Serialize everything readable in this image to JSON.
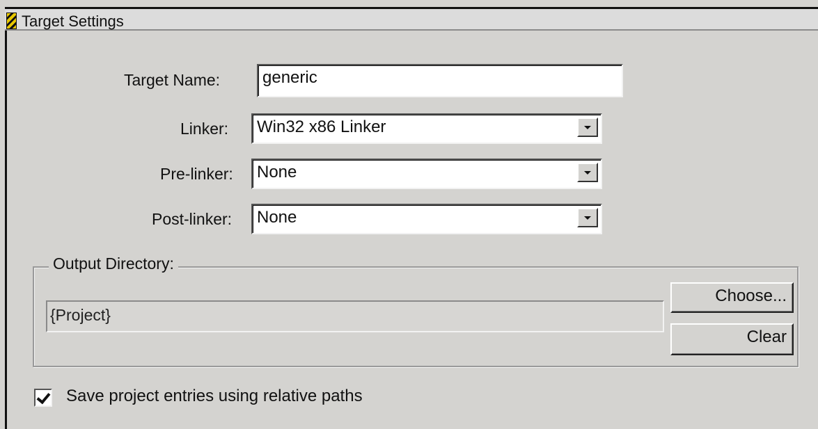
{
  "window": {
    "title": "Target Settings",
    "icon": "target-settings-icon"
  },
  "form": {
    "target_name_label": "Target Name:",
    "target_name_value": "generic",
    "linker_label": "Linker:",
    "linker_value": "Win32 x86 Linker",
    "prelinker_label": "Pre-linker:",
    "prelinker_value": "None",
    "postlinker_label": "Post-linker:",
    "postlinker_value": "None"
  },
  "output_directory": {
    "label": "Output Directory:",
    "value": "{Project}",
    "choose_label": "Choose...",
    "clear_label": "Clear"
  },
  "options": {
    "relative_paths_label": "Save project entries using relative paths",
    "relative_paths_checked": true
  },
  "icons": {
    "dropdown": "chevron-down-icon",
    "checkbox": "checkmark-icon"
  }
}
